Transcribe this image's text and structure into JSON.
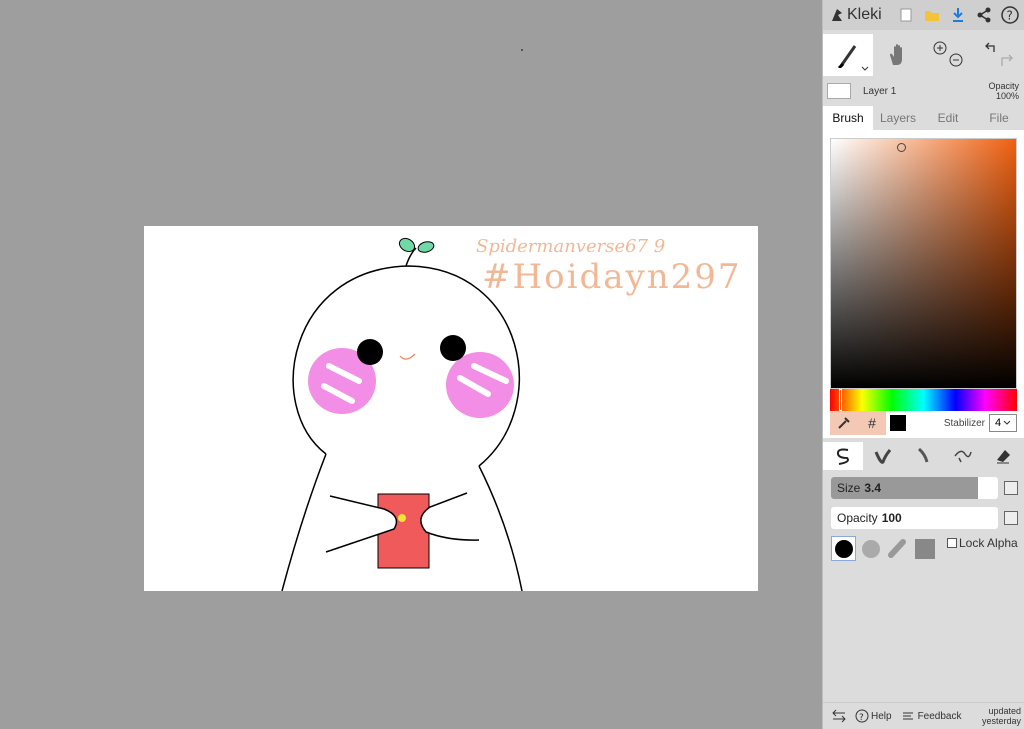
{
  "app": {
    "name": "Kleki"
  },
  "layer": {
    "name": "Layer 1",
    "opacity_label": "Opacity",
    "opacity_value": "100%"
  },
  "tabs": [
    {
      "label": "Brush",
      "active": true
    },
    {
      "label": "Layers",
      "active": false
    },
    {
      "label": "Edit",
      "active": false
    },
    {
      "label": "File",
      "active": false
    }
  ],
  "color": {
    "hex_symbol": "#",
    "current": "#000000",
    "stabilizer_label": "Stabilizer",
    "stabilizer_value": "4"
  },
  "brush": {
    "size_label": "Size",
    "size_value": "3.4",
    "size_fraction": 0.88,
    "opacity_label": "Opacity",
    "opacity_value": "100",
    "lock_alpha_label": "Lock Alpha"
  },
  "footer": {
    "help": "Help",
    "feedback": "Feedback",
    "updated_line1": "updated",
    "updated_line2": "yesterday"
  },
  "drawing": {
    "signature": "Spidermanverse67 9",
    "hashtag": "#Hoidayn297"
  }
}
